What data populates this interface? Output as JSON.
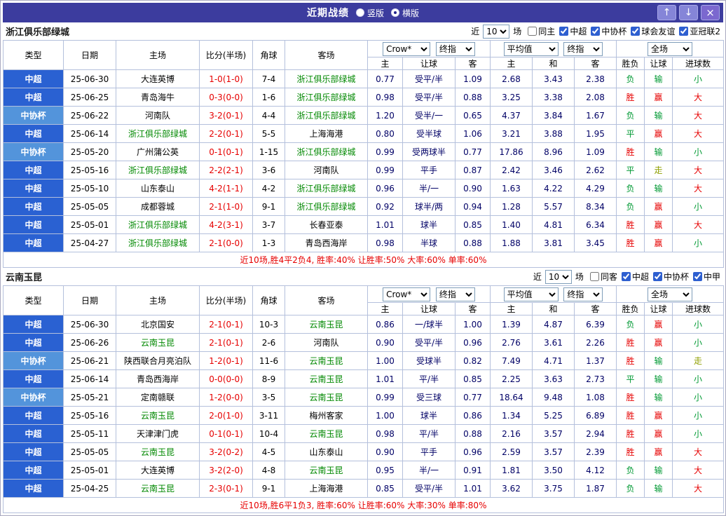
{
  "titlebar": {
    "title": "近期战绩",
    "layout_options": [
      {
        "label": "竖版",
        "selected": false
      },
      {
        "label": "横版",
        "selected": true
      }
    ],
    "buttons": {
      "up": "↑",
      "down": "↓",
      "close": "×"
    }
  },
  "colors": {
    "titlebar_bg": "#3c3c9e",
    "win_red": "#e60000",
    "loss_green": "#009933",
    "push_olive": "#8f9f00",
    "focus_team_green": "#008800",
    "league_super_blue": "#2a61d2",
    "league_cup_blue": "#5394db",
    "odds_navy": "#000066"
  },
  "columns": {
    "type": "类型",
    "date": "日期",
    "home": "主场",
    "score": "比分(半场)",
    "corner": "角球",
    "away": "客场",
    "odds_home": "主",
    "odds_line": "让球",
    "odds_away": "客",
    "avg_home": "主",
    "avg_draw": "和",
    "avg_away": "客",
    "result": "胜负",
    "line_result": "让球",
    "goals": "进球数"
  },
  "selects": {
    "bookmaker": "Crow*",
    "bookmaker_time": "终指",
    "average": "平均值",
    "average_time": "终指",
    "scope": "全场"
  },
  "sections": [
    {
      "team": "浙江俱乐部绿城",
      "filter": {
        "near_label": "近",
        "count": "10",
        "games_label": "场",
        "checkboxes": [
          {
            "label": "同主",
            "checked": false
          },
          {
            "label": "中超",
            "checked": true
          },
          {
            "label": "中协杯",
            "checked": true
          },
          {
            "label": "球会友谊",
            "checked": true
          },
          {
            "label": "亚冠联2",
            "checked": true
          }
        ]
      },
      "rows": [
        {
          "type": "中超",
          "date": "25-06-30",
          "home": "大连英博",
          "score": "1-0(1-0)",
          "corner": "7-4",
          "away": "浙江俱乐部绿城",
          "o1": "0.77",
          "line": "受平/半",
          "o2": "1.09",
          "h": "2.68",
          "d": "3.43",
          "a": "2.38",
          "r": "负",
          "hr": "输",
          "g": "小"
        },
        {
          "type": "中超",
          "date": "25-06-25",
          "home": "青岛海牛",
          "score": "0-3(0-0)",
          "corner": "1-6",
          "away": "浙江俱乐部绿城",
          "o1": "0.98",
          "line": "受平/半",
          "o2": "0.88",
          "h": "3.25",
          "d": "3.38",
          "a": "2.08",
          "r": "胜",
          "hr": "赢",
          "g": "大"
        },
        {
          "type": "中协杯",
          "date": "25-06-22",
          "home": "河南队",
          "score": "3-2(0-1)",
          "corner": "4-4",
          "away": "浙江俱乐部绿城",
          "o1": "1.20",
          "line": "受半/一",
          "o2": "0.65",
          "h": "4.37",
          "d": "3.84",
          "a": "1.67",
          "r": "负",
          "hr": "输",
          "g": "大"
        },
        {
          "type": "中超",
          "date": "25-06-14",
          "home": "浙江俱乐部绿城",
          "score": "2-2(0-1)",
          "corner": "5-5",
          "away": "上海海港",
          "o1": "0.80",
          "line": "受半球",
          "o2": "1.06",
          "h": "3.21",
          "d": "3.88",
          "a": "1.95",
          "r": "平",
          "hr": "赢",
          "g": "大"
        },
        {
          "type": "中协杯",
          "date": "25-05-20",
          "home": "广州蒲公英",
          "score": "0-1(0-1)",
          "corner": "1-15",
          "away": "浙江俱乐部绿城",
          "o1": "0.99",
          "line": "受两球半",
          "o2": "0.77",
          "h": "17.86",
          "d": "8.96",
          "a": "1.09",
          "r": "胜",
          "hr": "输",
          "g": "小"
        },
        {
          "type": "中超",
          "date": "25-05-16",
          "home": "浙江俱乐部绿城",
          "score": "2-2(2-1)",
          "corner": "3-6",
          "away": "河南队",
          "o1": "0.99",
          "line": "平手",
          "o2": "0.87",
          "h": "2.42",
          "d": "3.46",
          "a": "2.62",
          "r": "平",
          "hr": "走",
          "g": "大"
        },
        {
          "type": "中超",
          "date": "25-05-10",
          "home": "山东泰山",
          "score": "4-2(1-1)",
          "corner": "4-2",
          "away": "浙江俱乐部绿城",
          "o1": "0.96",
          "line": "半/一",
          "o2": "0.90",
          "h": "1.63",
          "d": "4.22",
          "a": "4.29",
          "r": "负",
          "hr": "输",
          "g": "大"
        },
        {
          "type": "中超",
          "date": "25-05-05",
          "home": "成都蓉城",
          "score": "2-1(1-0)",
          "corner": "9-1",
          "away": "浙江俱乐部绿城",
          "o1": "0.92",
          "line": "球半/两",
          "o2": "0.94",
          "h": "1.28",
          "d": "5.57",
          "a": "8.34",
          "r": "负",
          "hr": "赢",
          "g": "小"
        },
        {
          "type": "中超",
          "date": "25-05-01",
          "home": "浙江俱乐部绿城",
          "score": "4-2(3-1)",
          "corner": "3-7",
          "away": "长春亚泰",
          "o1": "1.01",
          "line": "球半",
          "o2": "0.85",
          "h": "1.40",
          "d": "4.81",
          "a": "6.34",
          "r": "胜",
          "hr": "赢",
          "g": "大"
        },
        {
          "type": "中超",
          "date": "25-04-27",
          "home": "浙江俱乐部绿城",
          "score": "2-1(0-0)",
          "corner": "1-3",
          "away": "青岛西海岸",
          "o1": "0.98",
          "line": "半球",
          "o2": "0.88",
          "h": "1.88",
          "d": "3.81",
          "a": "3.45",
          "r": "胜",
          "hr": "赢",
          "g": "小"
        }
      ],
      "summary": "近10场,胜4平2负4, 胜率:40% 让胜率:50% 大率:60% 单率:60%"
    },
    {
      "team": "云南玉昆",
      "filter": {
        "near_label": "近",
        "count": "10",
        "games_label": "场",
        "checkboxes": [
          {
            "label": "同客",
            "checked": false
          },
          {
            "label": "中超",
            "checked": true
          },
          {
            "label": "中协杯",
            "checked": true
          },
          {
            "label": "中甲",
            "checked": true
          }
        ]
      },
      "rows": [
        {
          "type": "中超",
          "date": "25-06-30",
          "home": "北京国安",
          "score": "2-1(0-1)",
          "corner": "10-3",
          "away": "云南玉昆",
          "o1": "0.86",
          "line": "一/球半",
          "o2": "1.00",
          "h": "1.39",
          "d": "4.87",
          "a": "6.39",
          "r": "负",
          "hr": "赢",
          "g": "小"
        },
        {
          "type": "中超",
          "date": "25-06-26",
          "home": "云南玉昆",
          "score": "2-1(0-1)",
          "corner": "2-6",
          "away": "河南队",
          "o1": "0.90",
          "line": "受平/半",
          "o2": "0.96",
          "h": "2.76",
          "d": "3.61",
          "a": "2.26",
          "r": "胜",
          "hr": "赢",
          "g": "小"
        },
        {
          "type": "中协杯",
          "date": "25-06-21",
          "home": "陕西联合月亮泊队",
          "score": "1-2(0-1)",
          "corner": "11-6",
          "away": "云南玉昆",
          "o1": "1.00",
          "line": "受球半",
          "o2": "0.82",
          "h": "7.49",
          "d": "4.71",
          "a": "1.37",
          "r": "胜",
          "hr": "输",
          "g": "走"
        },
        {
          "type": "中超",
          "date": "25-06-14",
          "home": "青岛西海岸",
          "score": "0-0(0-0)",
          "corner": "8-9",
          "away": "云南玉昆",
          "o1": "1.01",
          "line": "平/半",
          "o2": "0.85",
          "h": "2.25",
          "d": "3.63",
          "a": "2.73",
          "r": "平",
          "hr": "输",
          "g": "小"
        },
        {
          "type": "中协杯",
          "date": "25-05-21",
          "home": "定南赣联",
          "score": "1-2(0-0)",
          "corner": "3-5",
          "away": "云南玉昆",
          "o1": "0.99",
          "line": "受三球",
          "o2": "0.77",
          "h": "18.64",
          "d": "9.48",
          "a": "1.08",
          "r": "胜",
          "hr": "输",
          "g": "小"
        },
        {
          "type": "中超",
          "date": "25-05-16",
          "home": "云南玉昆",
          "score": "2-0(1-0)",
          "corner": "3-11",
          "away": "梅州客家",
          "o1": "1.00",
          "line": "球半",
          "o2": "0.86",
          "h": "1.34",
          "d": "5.25",
          "a": "6.89",
          "r": "胜",
          "hr": "赢",
          "g": "小"
        },
        {
          "type": "中超",
          "date": "25-05-11",
          "home": "天津津门虎",
          "score": "0-1(0-1)",
          "corner": "10-4",
          "away": "云南玉昆",
          "o1": "0.98",
          "line": "平/半",
          "o2": "0.88",
          "h": "2.16",
          "d": "3.57",
          "a": "2.94",
          "r": "胜",
          "hr": "赢",
          "g": "小"
        },
        {
          "type": "中超",
          "date": "25-05-05",
          "home": "云南玉昆",
          "score": "3-2(0-2)",
          "corner": "4-5",
          "away": "山东泰山",
          "o1": "0.90",
          "line": "平手",
          "o2": "0.96",
          "h": "2.59",
          "d": "3.57",
          "a": "2.39",
          "r": "胜",
          "hr": "赢",
          "g": "大"
        },
        {
          "type": "中超",
          "date": "25-05-01",
          "home": "大连英博",
          "score": "3-2(2-0)",
          "corner": "4-8",
          "away": "云南玉昆",
          "o1": "0.95",
          "line": "半/一",
          "o2": "0.91",
          "h": "1.81",
          "d": "3.50",
          "a": "4.12",
          "r": "负",
          "hr": "输",
          "g": "大"
        },
        {
          "type": "中超",
          "date": "25-04-25",
          "home": "云南玉昆",
          "score": "2-3(0-1)",
          "corner": "9-1",
          "away": "上海海港",
          "o1": "0.85",
          "line": "受平/半",
          "o2": "1.01",
          "h": "3.62",
          "d": "3.75",
          "a": "1.87",
          "r": "负",
          "hr": "输",
          "g": "大"
        }
      ],
      "summary": "近10场,胜6平1负3, 胜率:60% 让胜率:60% 大率:30% 单率:80%"
    }
  ]
}
